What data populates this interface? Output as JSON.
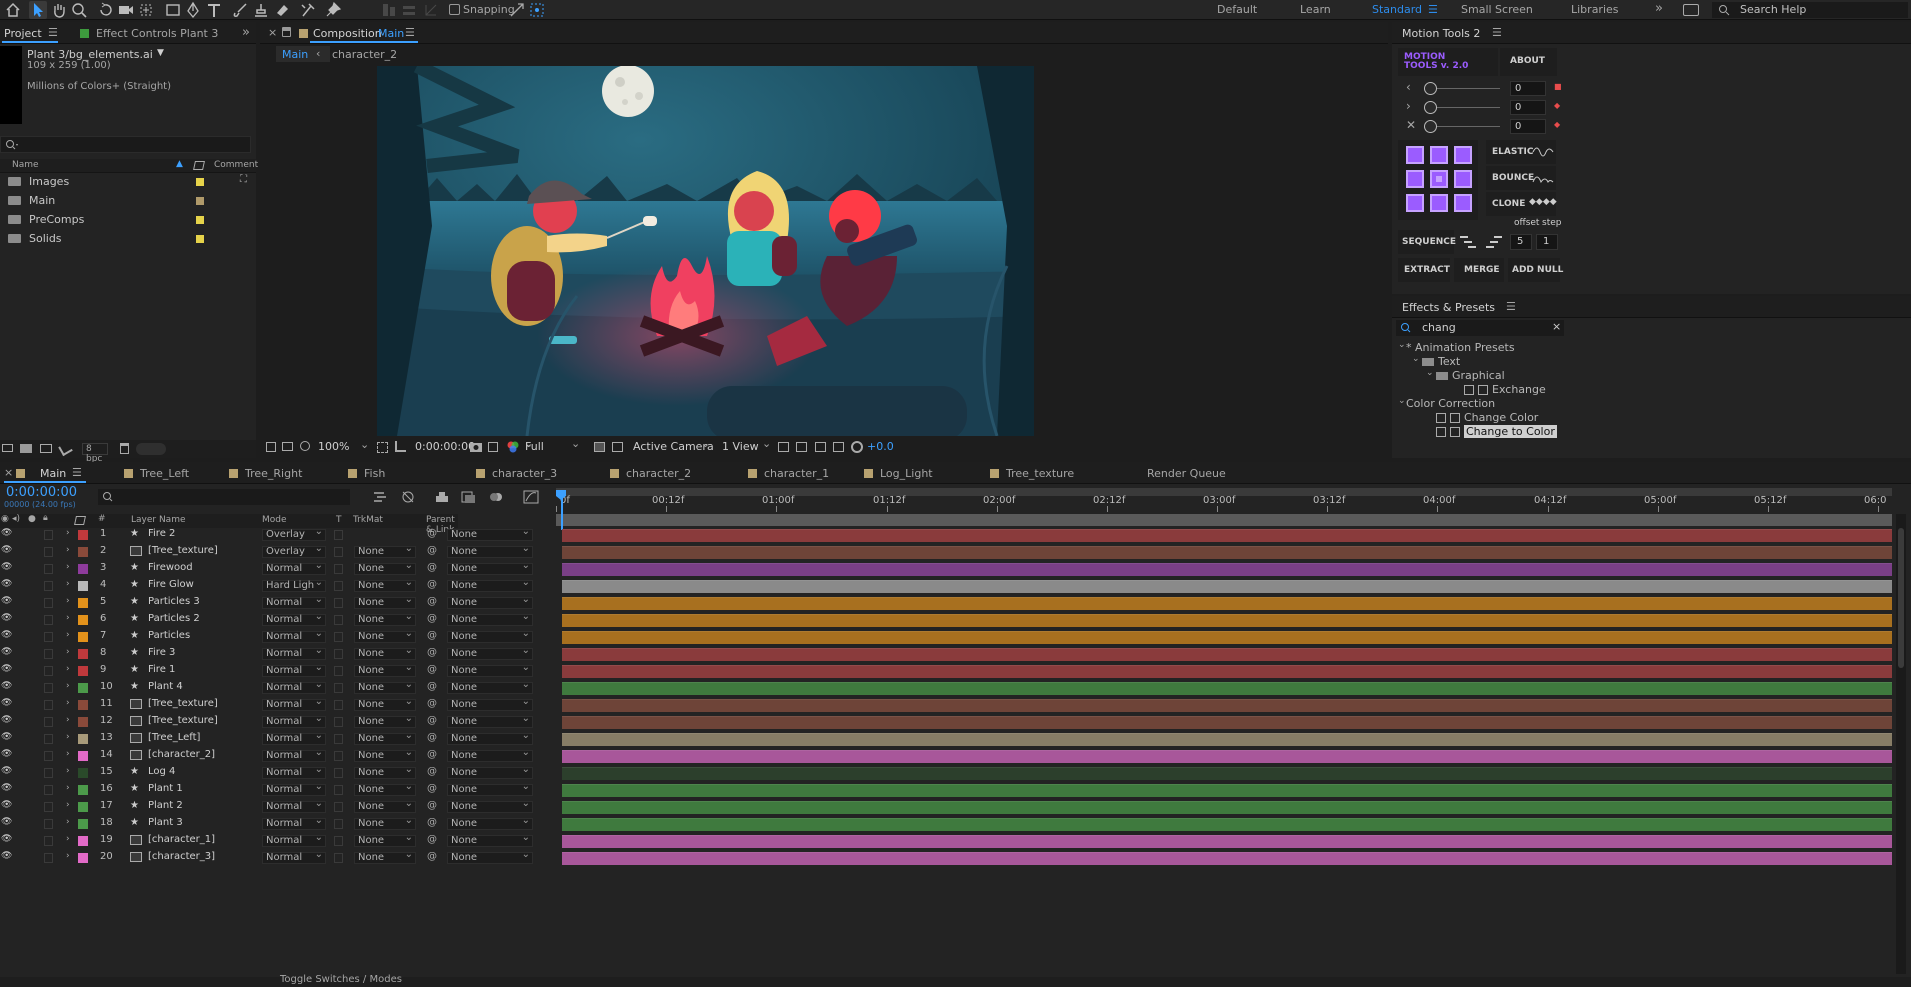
{
  "toolbar": {
    "snapping_label": "Snapping",
    "workspaces": [
      "Default",
      "Learn",
      "Standard",
      "Small Screen",
      "Libraries"
    ],
    "active_workspace": "Standard",
    "search_help_placeholder": "Search Help"
  },
  "project": {
    "tabs": [
      "Project",
      "Effect Controls Plant 3"
    ],
    "selected_item": "Plant 3/bg_elements.ai",
    "item_size": "109 x 259 (1.00)",
    "item_colors": "Millions of Colors+ (Straight)",
    "search_placeholder": "",
    "columns": [
      "Name",
      "Comment"
    ],
    "items": [
      {
        "name": "Images",
        "color": "#e6d34a"
      },
      {
        "name": "Main",
        "color": "#b09a6a"
      },
      {
        "name": "PreComps",
        "color": "#e6d34a"
      },
      {
        "name": "Solids",
        "color": "#e6d34a"
      }
    ],
    "bpc": "8 bpc"
  },
  "composition": {
    "panel_title": "Composition",
    "comp_name": "Main",
    "breadcrumbs": [
      "Main",
      "character_2"
    ],
    "zoom": "100%",
    "timecode": "0:00:00:00",
    "resolution": "Full",
    "camera": "Active Camera",
    "view": "1 View",
    "exposure": "+0.0"
  },
  "motion_tools": {
    "title": "Motion Tools 2",
    "logo_line1": "MOTION",
    "logo_line2": "TOOLS v. 2.0",
    "about": "ABOUT",
    "sliders": [
      {
        "icon": "chevron-left-icon",
        "value": "0"
      },
      {
        "icon": "chevron-right-icon",
        "value": "0"
      },
      {
        "icon": "chevron-both-icon",
        "value": "0"
      }
    ],
    "elastic": "ELASTIC",
    "bounce": "BOUNCE",
    "clone": "CLONE",
    "offset_label": "offset",
    "step_label": "step",
    "sequence": "SEQUENCE",
    "offset_value": "5",
    "step_value": "1",
    "extract": "EXTRACT",
    "merge": "MERGE",
    "add_null": "ADD NULL",
    "accent": "#9b5cff"
  },
  "effects": {
    "title": "Effects & Presets",
    "search_value": "chang",
    "tree": [
      {
        "label": "* Animation Presets",
        "level": 0,
        "type": "group"
      },
      {
        "label": "Text",
        "level": 1,
        "type": "folder"
      },
      {
        "label": "Graphical",
        "level": 2,
        "type": "folder"
      },
      {
        "label": "Exchange",
        "level": 3,
        "type": "preset"
      },
      {
        "label": "Color Correction",
        "level": 0,
        "type": "group"
      },
      {
        "label": "Change Color",
        "level": 1,
        "type": "effect"
      },
      {
        "label": "Change to Color",
        "level": 1,
        "type": "effect",
        "selected": true
      }
    ]
  },
  "timeline": {
    "tabs": [
      "Main",
      "Tree_Left",
      "Tree_Right",
      "Fish",
      "character_3",
      "character_2",
      "character_1",
      "Log_Light",
      "Tree_texture",
      "Render Queue"
    ],
    "timecode": "0:00:00:00",
    "frame_info": "00000 (24.00 fps)",
    "columns": {
      "layer_name": "Layer Name",
      "mode": "Mode",
      "t": "T",
      "trkmat": "TrkMat",
      "parent": "Parent & Link"
    },
    "ruler": [
      "0f",
      "00:12f",
      "01:00f",
      "01:12f",
      "02:00f",
      "02:12f",
      "03:00f",
      "03:12f",
      "04:00f",
      "04:12f",
      "05:00f",
      "05:12f",
      "06:0"
    ],
    "toggle_label": "Toggle Switches / Modes",
    "layers": [
      {
        "num": "1",
        "name": "Fire 2",
        "type": "star",
        "mode": "Overlay",
        "trkmat": "",
        "parent": "None",
        "color": "#c0393c",
        "bar": "#8a3b3c"
      },
      {
        "num": "2",
        "name": "[Tree_texture]",
        "type": "comp",
        "mode": "Overlay",
        "trkmat": "None",
        "parent": "None",
        "color": "#8a4a3a",
        "bar": "#6e4438"
      },
      {
        "num": "3",
        "name": "Firewood",
        "type": "star",
        "mode": "Normal",
        "trkmat": "None",
        "parent": "None",
        "color": "#8e3b9c",
        "bar": "#7a3f86"
      },
      {
        "num": "4",
        "name": "Fire Glow",
        "type": "star",
        "mode": "Hard Ligh",
        "trkmat": "None",
        "parent": "None",
        "color": "#b9b9b9",
        "bar": "#8a8a8a"
      },
      {
        "num": "5",
        "name": "Particles 3",
        "type": "star",
        "mode": "Normal",
        "trkmat": "None",
        "parent": "None",
        "color": "#e3921b",
        "bar": "#a8701f"
      },
      {
        "num": "6",
        "name": "Particles 2",
        "type": "star",
        "mode": "Normal",
        "trkmat": "None",
        "parent": "None",
        "color": "#e3921b",
        "bar": "#a8701f"
      },
      {
        "num": "7",
        "name": "Particles",
        "type": "star",
        "mode": "Normal",
        "trkmat": "None",
        "parent": "None",
        "color": "#e3921b",
        "bar": "#a8701f"
      },
      {
        "num": "8",
        "name": "Fire 3",
        "type": "star",
        "mode": "Normal",
        "trkmat": "None",
        "parent": "None",
        "color": "#c0393c",
        "bar": "#8a3b3c"
      },
      {
        "num": "9",
        "name": "Fire 1",
        "type": "star",
        "mode": "Normal",
        "trkmat": "None",
        "parent": "None",
        "color": "#c0393c",
        "bar": "#8a3b3c"
      },
      {
        "num": "10",
        "name": "Plant 4",
        "type": "star",
        "mode": "Normal",
        "trkmat": "None",
        "parent": "None",
        "color": "#4c9a4a",
        "bar": "#3f7a3e"
      },
      {
        "num": "11",
        "name": "[Tree_texture]",
        "type": "comp",
        "mode": "Normal",
        "trkmat": "None",
        "parent": "None",
        "color": "#8a4a3a",
        "bar": "#6e4438"
      },
      {
        "num": "12",
        "name": "[Tree_texture]",
        "type": "comp",
        "mode": "Normal",
        "trkmat": "None",
        "parent": "None",
        "color": "#8a4a3a",
        "bar": "#6e4438"
      },
      {
        "num": "13",
        "name": "[Tree_Left]",
        "type": "comp",
        "mode": "Normal",
        "trkmat": "None",
        "parent": "None",
        "color": "#a89a7a",
        "bar": "#877d66"
      },
      {
        "num": "14",
        "name": "[character_2]",
        "type": "comp",
        "mode": "Normal",
        "trkmat": "None",
        "parent": "None",
        "color": "#e26ac7",
        "bar": "#a8579a"
      },
      {
        "num": "15",
        "name": "Log 4",
        "type": "star",
        "mode": "Normal",
        "trkmat": "None",
        "parent": "None",
        "color": "#2a4a2a",
        "bar": "#2c3f2c"
      },
      {
        "num": "16",
        "name": "Plant 1",
        "type": "star",
        "mode": "Normal",
        "trkmat": "None",
        "parent": "None",
        "color": "#4c9a4a",
        "bar": "#3f7a3e"
      },
      {
        "num": "17",
        "name": "Plant 2",
        "type": "star",
        "mode": "Normal",
        "trkmat": "None",
        "parent": "None",
        "color": "#4c9a4a",
        "bar": "#3f7a3e"
      },
      {
        "num": "18",
        "name": "Plant 3",
        "type": "star",
        "mode": "Normal",
        "trkmat": "None",
        "parent": "None",
        "color": "#4c9a4a",
        "bar": "#3f7a3e"
      },
      {
        "num": "19",
        "name": "[character_1]",
        "type": "comp",
        "mode": "Normal",
        "trkmat": "None",
        "parent": "None",
        "color": "#e26ac7",
        "bar": "#a8579a"
      },
      {
        "num": "20",
        "name": "[character_3]",
        "type": "comp",
        "mode": "Normal",
        "trkmat": "None",
        "parent": "None",
        "color": "#e26ac7",
        "bar": "#a8579a"
      }
    ]
  }
}
